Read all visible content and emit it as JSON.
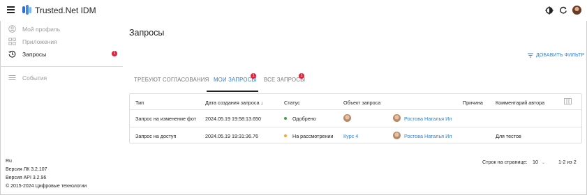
{
  "header": {
    "app_title": "Trusted.Net IDM"
  },
  "sidebar": {
    "items": [
      {
        "label": "Мой профиль",
        "icon": "user-circle-icon"
      },
      {
        "label": "Приложения",
        "icon": "apps-grid-icon"
      },
      {
        "label": "Запросы",
        "icon": "history-icon",
        "badge": "1"
      },
      {
        "label": "События",
        "icon": "list-icon"
      }
    ],
    "footer": {
      "lang": "Ru",
      "lk_version": "Версия ЛК 3.2.107",
      "api_version": "Версия API 3.2.96",
      "copyright": "© 2015-2024 Цифровые технологии"
    }
  },
  "main": {
    "title": "Запросы",
    "add_filter": "ДОБАВИТЬ ФИЛЬТР",
    "tabs": [
      {
        "label": "ТРЕБУЮТ СОГЛАСОВАНИЯ"
      },
      {
        "label": "МОИ ЗАПРОСЫ",
        "badge": "1"
      },
      {
        "label": "ВСЕ ЗАПРОСЫ",
        "badge": "1"
      }
    ],
    "table": {
      "columns": [
        "Тип",
        "Дата создания запроса",
        "Статус",
        "Объект запроса",
        "Причина",
        "Комментарий автора"
      ],
      "sort_arrow": "↓",
      "rows": [
        {
          "type": "Запрос на изменение фот",
          "date": "2024.05.19 19:58:13.650",
          "status": "Одобрено",
          "status_color": "#43a047",
          "object": "",
          "user": "Ростова Наталья Ил",
          "reason": "",
          "comment": ""
        },
        {
          "type": "Запрос на доступ",
          "date": "2024.05.19 19:31:36.76",
          "status": "На рассмотрении",
          "status_color": "#f5a623",
          "object": "Курс 4",
          "user": "Ростова Наталья Ил",
          "reason": "",
          "comment": "Для тестов"
        }
      ]
    },
    "pagination": {
      "rows_per_page_label": "Строк на странице:",
      "rows_per_page": "10",
      "range": "1-2 из 2"
    }
  },
  "colors": {
    "accent": "#2f7fd6",
    "badge": "#e0203a"
  }
}
